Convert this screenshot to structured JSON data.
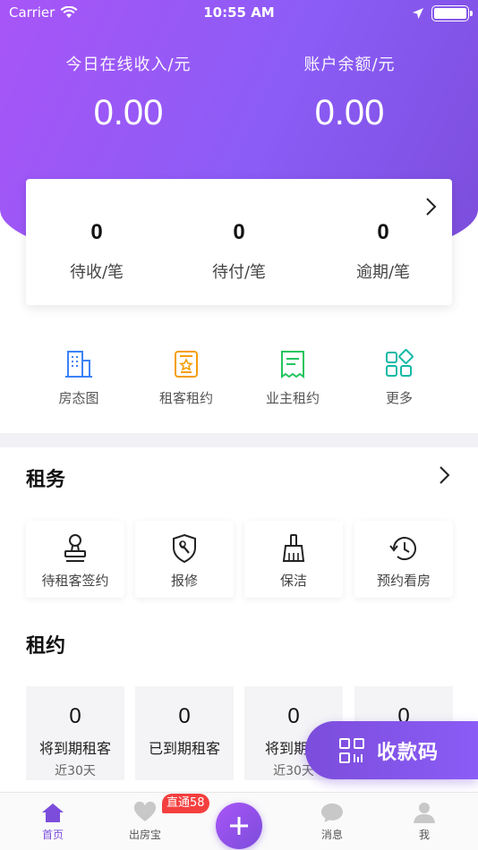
{
  "status_bar": {
    "carrier": "Carrier",
    "time": "10:55 AM"
  },
  "income": {
    "today_label": "今日在线收入/元",
    "today_value": "0.00",
    "balance_label": "账户余额/元",
    "balance_value": "0.00"
  },
  "stats": [
    {
      "value": "0",
      "label": "待收/笔"
    },
    {
      "value": "0",
      "label": "待付/笔"
    },
    {
      "value": "0",
      "label": "逾期/笔"
    }
  ],
  "quick_actions": [
    {
      "label": "房态图",
      "icon": "building-icon",
      "color": "#3b82f6"
    },
    {
      "label": "租客租约",
      "icon": "tenant-contract-icon",
      "color": "#f59e0b"
    },
    {
      "label": "业主租约",
      "icon": "receipt-icon",
      "color": "#22c55e"
    },
    {
      "label": "更多",
      "icon": "grid-more-icon",
      "color": "#14b8a6"
    }
  ],
  "rent_section": {
    "title": "租务",
    "tiles": [
      {
        "label": "待租客签约",
        "icon": "stamp-icon"
      },
      {
        "label": "报修",
        "icon": "wrench-shield-icon"
      },
      {
        "label": "保洁",
        "icon": "broom-icon"
      },
      {
        "label": "预约看房",
        "icon": "clock-history-icon"
      }
    ]
  },
  "lease_section": {
    "title": "租约",
    "cards": [
      {
        "value": "0",
        "label": "将到期租客",
        "sub": "近30天"
      },
      {
        "value": "0",
        "label": "已到期租客",
        "sub": ""
      },
      {
        "value": "0",
        "label": "将到期业",
        "sub": "近30天"
      },
      {
        "value": "0",
        "label": "",
        "sub": ""
      }
    ]
  },
  "collect_button": {
    "label": "收款码"
  },
  "tabbar": {
    "items": [
      {
        "label": "首页"
      },
      {
        "label": "出房宝"
      },
      {
        "label": "消息"
      },
      {
        "label": "我"
      }
    ],
    "badge": "直通58"
  },
  "colors": {
    "accent": "#7c4ddb",
    "hero_start": "#a855f7",
    "badge": "#f43f3f"
  }
}
